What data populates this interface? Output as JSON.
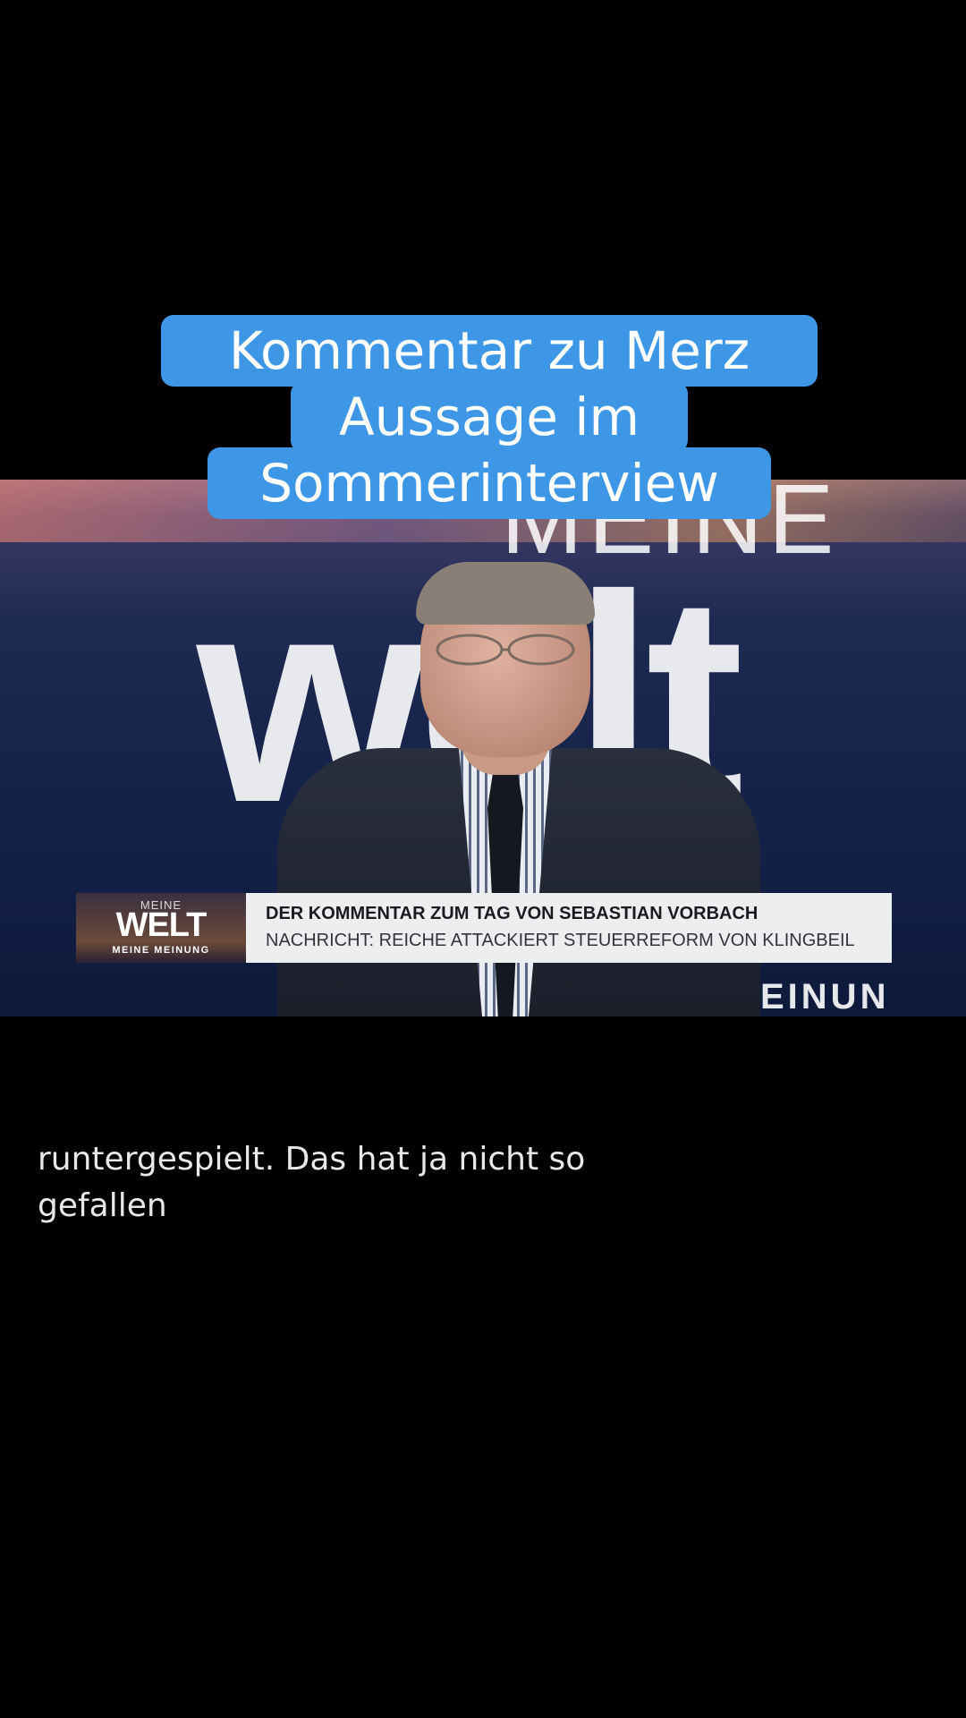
{
  "title_overlay": {
    "line1": "Kommentar zu Merz",
    "line2": "Aussage im",
    "line3": "Sommerinterview",
    "color": "#3d97e6"
  },
  "video": {
    "background_text": {
      "meine": "MEINE",
      "welt": "welt",
      "meinung": "EINUN"
    },
    "lower_third": {
      "logo_top": "MEINE",
      "logo_main": "WELT",
      "logo_bottom": "MEINE MEINUNG",
      "headline": "DER KOMMENTAR ZUM TAG VON SEBASTIAN VORBACH",
      "subline": "NACHRICHT: REICHE ATTACKIERT STEUERREFORM VON KLINGBEIL"
    }
  },
  "caption": {
    "line1": "runtergespielt. Das hat ja nicht so",
    "line2": "gefallen"
  }
}
